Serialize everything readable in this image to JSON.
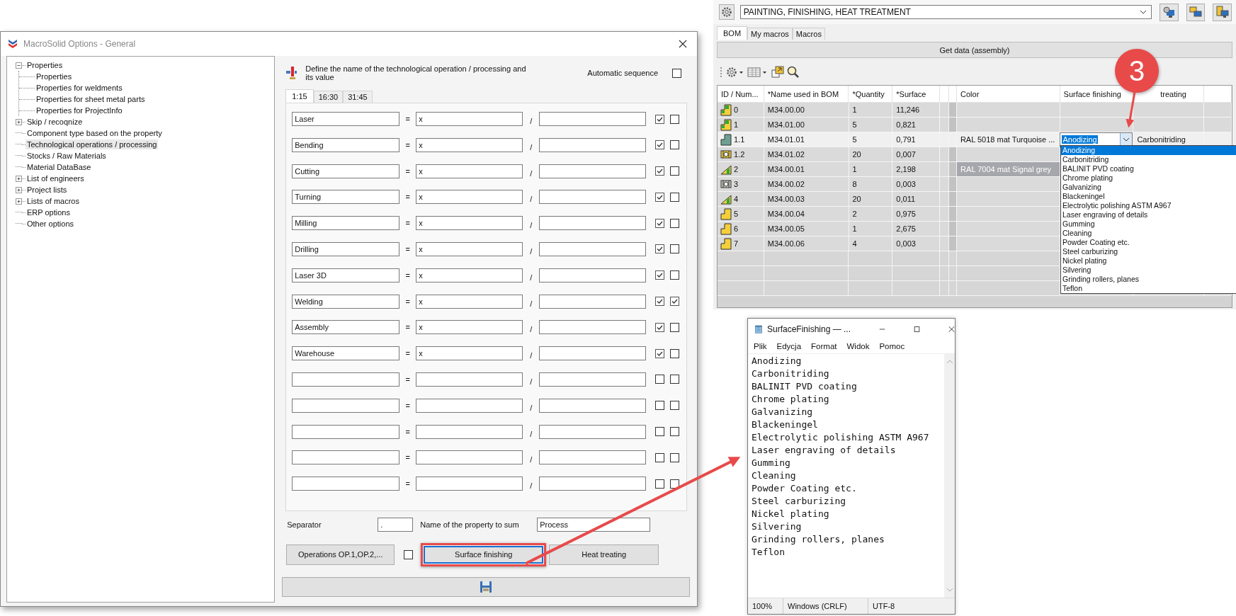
{
  "options_window": {
    "title": "MacroSolid Options - General",
    "tree": [
      {
        "label": "Properties",
        "expanded": true,
        "selected": false,
        "children": [
          {
            "label": "Properties",
            "selected": false
          },
          {
            "label": "Properties for weldments",
            "selected": false
          },
          {
            "label": "Properties for sheet metal parts",
            "selected": false
          },
          {
            "label": "Properties for ProjectInfo",
            "selected": false
          }
        ]
      },
      {
        "label": "Skip / recoqnize",
        "expanded": false,
        "selected": false
      },
      {
        "label": "Component type based on the property",
        "selected": false
      },
      {
        "label": "Technological operations / processing",
        "selected": true
      },
      {
        "label": "Stocks / Raw Materials",
        "selected": false
      },
      {
        "label": "Material DataBase",
        "selected": false
      },
      {
        "label": "List of engineers",
        "expanded": false,
        "selected": false
      },
      {
        "label": "Project lists",
        "expanded": false,
        "selected": false
      },
      {
        "label": "Lists of macros",
        "expanded": false,
        "selected": false
      },
      {
        "label": "ERP options",
        "selected": false
      },
      {
        "label": "Other options",
        "selected": false
      }
    ],
    "header": "Define the name of the technological operation / processing and its value",
    "automatic_sequence": {
      "label": "Automatic sequence",
      "checked": false
    },
    "tabs": [
      {
        "label": "1:15",
        "selected": true
      },
      {
        "label": "16:30",
        "selected": false
      },
      {
        "label": "31:45",
        "selected": false
      }
    ],
    "equals_sign": "=",
    "slash_sign": "/",
    "operations": [
      {
        "name": "Laser",
        "value": "x",
        "check_1": true,
        "check_2": false
      },
      {
        "name": "Bending",
        "value": "x",
        "check_1": true,
        "check_2": false
      },
      {
        "name": "Cutting",
        "value": "x",
        "check_1": true,
        "check_2": false
      },
      {
        "name": "Turning",
        "value": "x",
        "check_1": true,
        "check_2": false
      },
      {
        "name": "Milling",
        "value": "x",
        "check_1": true,
        "check_2": false
      },
      {
        "name": "Drilling",
        "value": "x",
        "check_1": true,
        "check_2": false
      },
      {
        "name": "Laser 3D",
        "value": "x",
        "check_1": true,
        "check_2": false
      },
      {
        "name": "Welding",
        "value": "x",
        "check_1": true,
        "check_2": true
      },
      {
        "name": "Assembly",
        "value": "x",
        "check_1": true,
        "check_2": false
      },
      {
        "name": "Warehouse",
        "value": "x",
        "check_1": true,
        "check_2": false
      },
      {
        "check_1": false,
        "check_2": false
      },
      {
        "check_1": false,
        "check_2": false
      },
      {
        "check_1": false,
        "check_2": false
      },
      {
        "check_1": false,
        "check_2": false
      },
      {
        "check_1": false,
        "check_2": false
      }
    ],
    "separator": {
      "label": "Separator",
      "value": "."
    },
    "property_to_sum": {
      "label": "Name of the property to sum",
      "value": "Process"
    },
    "operations_button": "Operations OP.1,OP.2,...",
    "operations_checked": false,
    "surface_button": "Surface finishing",
    "heat_button": "Heat treating"
  },
  "bom_panel": {
    "preset": "PAINTING, FINISHING, HEAT TREATMENT",
    "tabs": [
      {
        "label": "BOM",
        "selected": true
      },
      {
        "label": "My macros",
        "selected": false
      },
      {
        "label": "Macros",
        "selected": false
      }
    ],
    "get_data_button": "Get data (assembly)",
    "columns": [
      "ID / Num...",
      "*Name used in BOM",
      "*Quantity",
      "*Surface",
      "Color",
      "Surface finishing",
      "treating"
    ],
    "rows": [
      {
        "kind": "assembly",
        "id": "0",
        "name": "M34.00.00",
        "quantity": "1",
        "surface": "11,246",
        "selected": false
      },
      {
        "kind": "assembly",
        "id": "1",
        "name": "M34.01.00",
        "quantity": "5",
        "surface": "0,821",
        "selected": false
      },
      {
        "kind": "profile",
        "id": "1.1",
        "name": "M34.01.01",
        "quantity": "5",
        "surface": "0,791",
        "color_name": "RAL 5018 mat Turquoise ...",
        "finishing": "Anodizing",
        "heat": "Carbonitriding",
        "selected": true
      },
      {
        "kind": "weldment",
        "id": "1.2",
        "name": "M34.01.02",
        "quantity": "20",
        "surface": "0,007",
        "selected": false
      },
      {
        "kind": "sheet",
        "id": "2",
        "name": "M34.00.01",
        "quantity": "1",
        "surface": "2,198",
        "color_name": "RAL 7004 mat Signal grey",
        "selected": false
      },
      {
        "kind": "frame",
        "id": "3",
        "name": "M34.00.02",
        "quantity": "8",
        "surface": "0,003",
        "selected": false
      },
      {
        "kind": "sheet",
        "id": "4",
        "name": "M34.00.03",
        "quantity": "20",
        "surface": "0,011",
        "selected": false
      },
      {
        "kind": "bracket",
        "id": "5",
        "name": "M34.00.04",
        "quantity": "2",
        "surface": "0,975",
        "selected": false
      },
      {
        "kind": "bracket",
        "id": "6",
        "name": "M34.00.05",
        "quantity": "1",
        "surface": "2,675",
        "selected": false
      },
      {
        "kind": "bracket",
        "id": "7",
        "name": "M34.00.06",
        "quantity": "4",
        "surface": "0,003",
        "selected": false
      }
    ],
    "dropdown": [
      {
        "label": "Anodizing",
        "selected": true
      },
      {
        "label": "Carbonitriding",
        "selected": false
      },
      {
        "label": "BALINIT PVD coating",
        "selected": false
      },
      {
        "label": "Chrome plating",
        "selected": false
      },
      {
        "label": "Galvanizing",
        "selected": false
      },
      {
        "label": "Blackeningel",
        "selected": false
      },
      {
        "label": "Electrolytic polishing ASTM A967",
        "selected": false
      },
      {
        "label": "Laser engraving of details",
        "selected": false
      },
      {
        "label": "Gumming",
        "selected": false
      },
      {
        "label": "Cleaning",
        "selected": false
      },
      {
        "label": "Powder Coating etc.",
        "selected": false
      },
      {
        "label": "Steel carburizing",
        "selected": false
      },
      {
        "label": "Nickel plating",
        "selected": false
      },
      {
        "label": "Silvering",
        "selected": false
      },
      {
        "label": "Grinding rollers, planes",
        "selected": false
      },
      {
        "label": "Teflon",
        "selected": false
      }
    ]
  },
  "callout": "3",
  "notepad": {
    "title": "SurfaceFinishing — ...",
    "menu": [
      "Plik",
      "Edycja",
      "Format",
      "Widok",
      "Pomoc"
    ],
    "lines": [
      "Anodizing",
      "Carbonitriding",
      "BALINIT PVD coating",
      "Chrome plating",
      "Galvanizing",
      "Blackeningel",
      "Electrolytic polishing ASTM A967",
      "Laser engraving of details",
      "Gumming",
      "Cleaning",
      "Powder Coating etc.",
      "Steel carburizing",
      "Nickel plating",
      "Silvering",
      "Grinding rollers, planes",
      "Teflon"
    ],
    "status": [
      "100%",
      "Windows (CRLF)",
      "UTF-8"
    ]
  }
}
